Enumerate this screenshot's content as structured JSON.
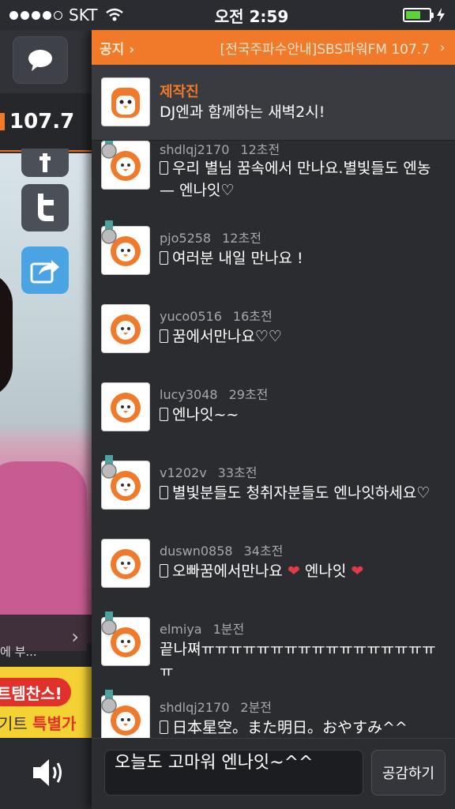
{
  "status_bar": {
    "carrier": "SKT",
    "time": "오전 2:59",
    "battery_level": 0.55,
    "signal_bars": 4,
    "signal_total": 5
  },
  "left_panel": {
    "frequency": "107.7",
    "ad_text_small": "에 부...",
    "ad_badge": "트템찬스!",
    "ad_line_a": "기트",
    "ad_line_b": "특별가"
  },
  "notice": {
    "label": "공지",
    "text": "[전국주파수안내]SBS파워FM 107.7"
  },
  "producer": {
    "name": "제작진",
    "text": "DJ엔과 함께하는 새벽2시!"
  },
  "messages": [
    {
      "user": "shdlqj2170",
      "time": "12초전",
      "text": "우리 별님 꿈속에서 만나요.별빛들도 엔농— 엔나잇♡",
      "medal": true
    },
    {
      "user": "pjo5258",
      "time": "12초전",
      "text": "여러분 내일 만나요 !",
      "medal": true
    },
    {
      "user": "yuco0516",
      "time": "16초전",
      "text": "꿈에서만나요♡♡",
      "medal": false
    },
    {
      "user": "lucy3048",
      "time": "29초전",
      "text": "엔나잇~~",
      "medal": false
    },
    {
      "user": "v1202v",
      "time": "33초전",
      "text": "별빛분들도 청취자분들도 엔나잇하세요♡",
      "medal": true
    },
    {
      "user": "duswn0858",
      "time": "34초전",
      "text": "오빠꿈에서만나요",
      "text2": "엔나잇",
      "medal": false,
      "hearts": true
    },
    {
      "user": "elmiya",
      "time": "1분전",
      "text": "끝나쪄ㅠㅠㅠㅠㅠㅠㅠㅠㅠㅠㅠㅠㅠㅠㅠㅠㅠㅠ",
      "medal": true,
      "no_phone": true
    },
    {
      "user": "shdlqj2170",
      "time": "2분전",
      "text": "日本星空。また明日。おやすみ^^",
      "medal": true
    }
  ],
  "input": {
    "value": "오늘도 고마워 엔나잇~^^"
  },
  "send_button": {
    "label": "공감하기"
  },
  "colors": {
    "accent": "#f07a2a",
    "panel": "#2a2c30",
    "heart": "#e23b4a"
  }
}
